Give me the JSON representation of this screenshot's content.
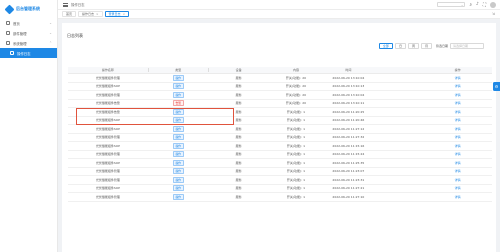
{
  "app": {
    "title": "后台管理系统"
  },
  "sidebar": {
    "items": [
      {
        "label": "首页"
      },
      {
        "label": "部件管理"
      },
      {
        "label": "系统管理"
      },
      {
        "label": "操作日志"
      }
    ]
  },
  "topbar": {
    "breadcrumb": "操作日志",
    "select_placeholder": ""
  },
  "tabs": [
    {
      "label": "首页"
    },
    {
      "label": "操作日志"
    },
    {
      "label": "登录日志"
    }
  ],
  "page": {
    "title": "日志列表"
  },
  "filters": {
    "buttons": [
      "全部",
      "日",
      "周",
      "月"
    ],
    "date_label": "筛选日期",
    "date_placeholder": "请选择日期"
  },
  "table": {
    "headers": [
      "操作名称",
      "类型",
      "设备",
      "内容",
      "时间",
      "操作"
    ],
    "rows": [
      {
        "name": "光伏储能组件管理",
        "type": "操作",
        "type_kind": "op",
        "device": "服务",
        "content": "开关(功能): 20",
        "time": "2022-06-20 13:10:04",
        "action": "详情"
      },
      {
        "name": "光伏储能组件SOP",
        "type": "操作",
        "type_kind": "op",
        "device": "服务",
        "content": "开关(功能): 20",
        "time": "2022-06-20 13:10:13",
        "action": "详情"
      },
      {
        "name": "光伏储能组件管理",
        "type": "操作",
        "type_kind": "op",
        "device": "服务",
        "content": "开关(功能): 20",
        "time": "2022-06-20 13:10:04",
        "action": "详情"
      },
      {
        "name": "光伏储能组件告警",
        "type": "告警",
        "type_kind": "err",
        "device": "服务",
        "content": "开关(功能): 20",
        "time": "2022-06-20 13:10:11",
        "action": "详情"
      },
      {
        "name": "光伏储能组件告警",
        "type": "操作",
        "type_kind": "op",
        "device": "服务",
        "content": "开关(功能): 1",
        "time": "2022-06-20 11:20:25",
        "action": "详情"
      },
      {
        "name": "光伏储能组件SOP",
        "type": "操作",
        "type_kind": "op",
        "device": "服务",
        "content": "开关(功能): 1",
        "time": "2022-06-20 11:20:46",
        "action": "详情"
      },
      {
        "name": "光伏储能组件SOP",
        "type": "操作",
        "type_kind": "op",
        "device": "服务",
        "content": "开关(功能): 1",
        "time": "2022-06-20 11:27:12",
        "action": "详情"
      },
      {
        "name": "光伏储能组件管理",
        "type": "操作",
        "type_kind": "op",
        "device": "服务",
        "content": "开关(功能): 1",
        "time": "2022-06-20 11:27:32",
        "action": "详情"
      },
      {
        "name": "光伏储能组件SOP",
        "type": "操作",
        "type_kind": "op",
        "device": "服务",
        "content": "开关(功能): 1",
        "time": "2022-06-20 11:15:16",
        "action": "详情"
      },
      {
        "name": "光伏储能组件管理",
        "type": "操作",
        "type_kind": "op",
        "device": "服务",
        "content": "开关(功能): 1",
        "time": "2022-06-20 11:15:24",
        "action": "详情"
      },
      {
        "name": "光伏储能组件SOP",
        "type": "操作",
        "type_kind": "op",
        "device": "服务",
        "content": "开关(功能): 1",
        "time": "2022-06-20 11:25:35",
        "action": "详情"
      },
      {
        "name": "光伏储能组件管理",
        "type": "操作",
        "type_kind": "op",
        "device": "服务",
        "content": "开关(功能): 1",
        "time": "2022-06-20 11:23:07",
        "action": "详情"
      },
      {
        "name": "光伏储能组件管理",
        "type": "操作",
        "type_kind": "op",
        "device": "服务",
        "content": "开关(功能): 1",
        "time": "2022-06-20 11:23:31",
        "action": "详情"
      },
      {
        "name": "光伏储能组件SOP",
        "type": "操作",
        "type_kind": "op",
        "device": "服务",
        "content": "开关(功能): 1",
        "time": "2022-06-20 11:27:21",
        "action": "详情"
      },
      {
        "name": "光伏储能组件管理",
        "type": "操作",
        "type_kind": "op",
        "device": "服务",
        "content": "开关(功能): 1",
        "time": "2022-06-20 11:27:10",
        "action": "详情"
      }
    ]
  },
  "colors": {
    "accent": "#1e88e5",
    "alert": "#e53935",
    "highlight_box": "#e0533d"
  }
}
